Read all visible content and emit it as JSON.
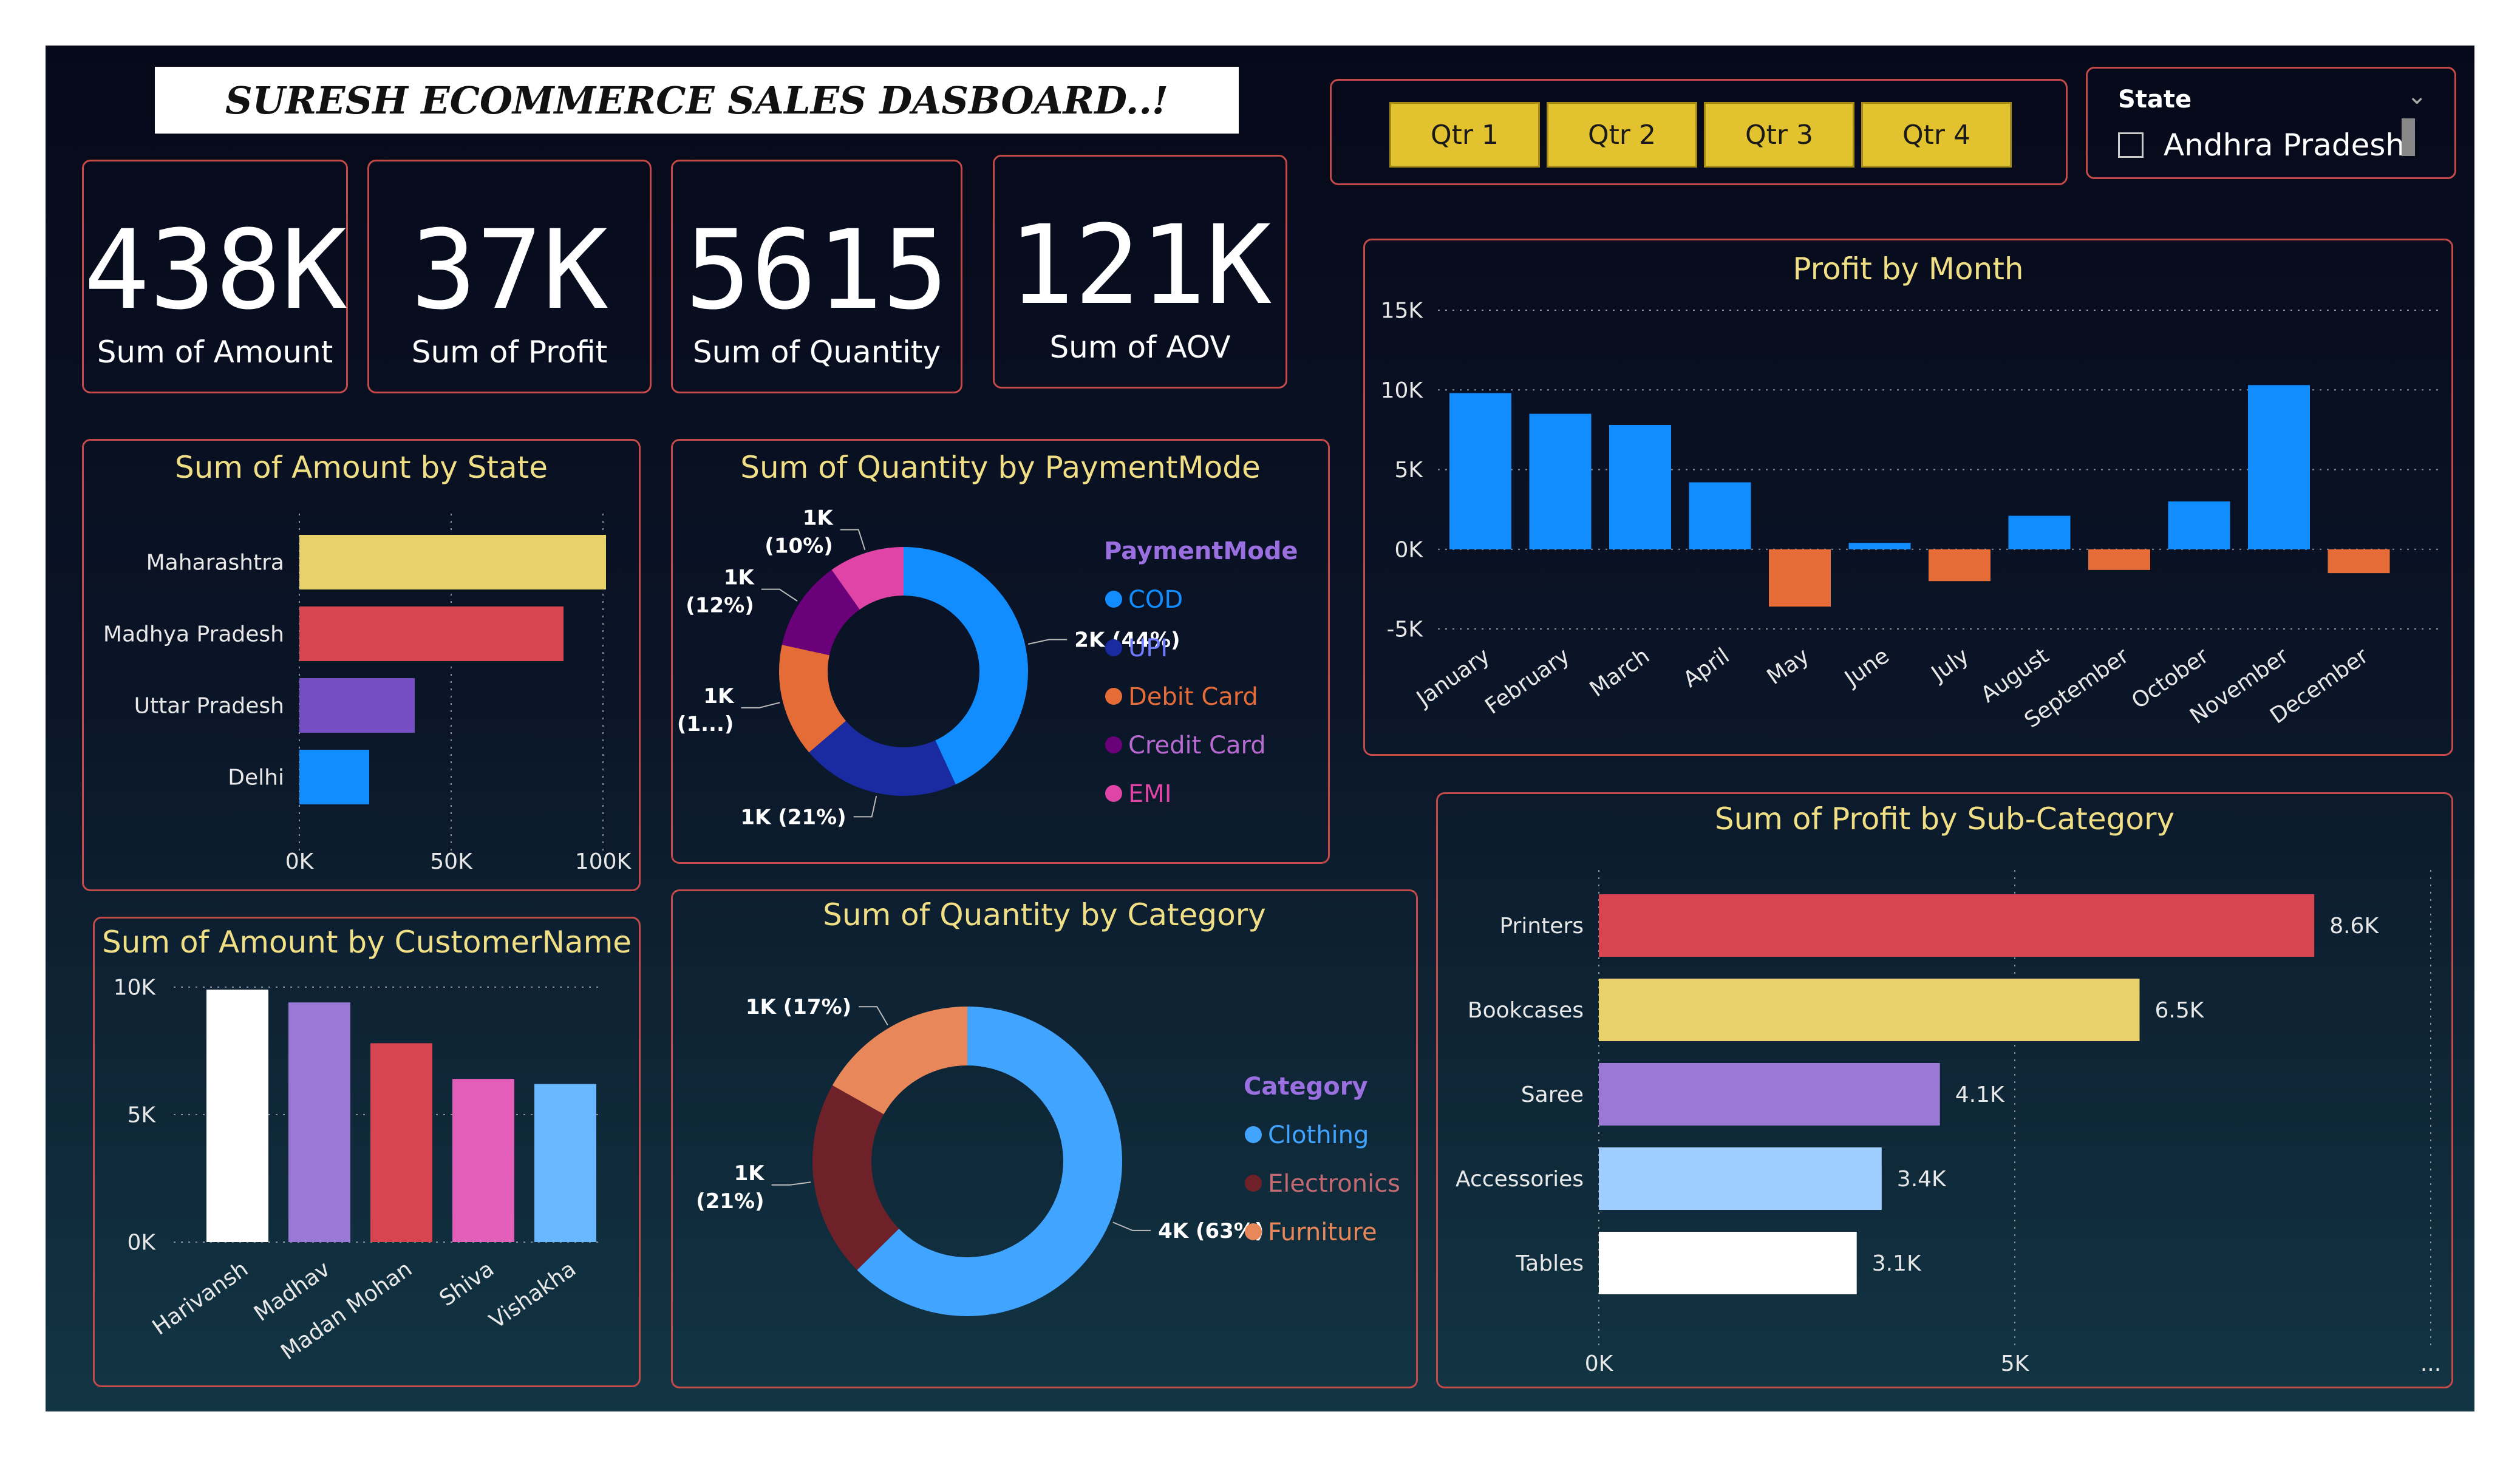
{
  "title": "SURESH ECOMMERCE  SALES DASBOARD..!",
  "kpis": [
    {
      "value": "438K",
      "label": "Sum of Amount"
    },
    {
      "value": "37K",
      "label": "Sum of Profit"
    },
    {
      "value": "5615",
      "label": "Sum of Quantity"
    },
    {
      "value": "121K",
      "label": "Sum of AOV"
    }
  ],
  "quarters": [
    "Qtr 1",
    "Qtr 2",
    "Qtr 3",
    "Qtr 4"
  ],
  "state_slicer": {
    "header": "State",
    "option": "Andhra Pradesh",
    "checked": false
  },
  "colors": {
    "accent": "#e3c230",
    "border": "#c44a4a",
    "title_text": "#f1df86",
    "blue": "#118dff",
    "orange": "#e66c37"
  },
  "chart_data": [
    {
      "type": "bar",
      "orientation": "horizontal",
      "title": "Sum of Amount by State",
      "categories": [
        "Maharashtra",
        "Madhya Pradesh",
        "Uttar Pradesh",
        "Delhi"
      ],
      "values": [
        101000,
        87000,
        38000,
        23000
      ],
      "colors": [
        "#e8d06a",
        "#d64550",
        "#744ec2",
        "#118dff"
      ],
      "xticks": [
        "0K",
        "50K",
        "100K"
      ],
      "xlim": [
        0,
        100000
      ],
      "grid": true
    },
    {
      "type": "pie",
      "subtype": "donut",
      "title": "Sum of Quantity by PaymentMode",
      "legend_title": "PaymentMode",
      "labels": [
        "COD",
        "UPI",
        "Debit Card",
        "Credit Card",
        "EMI"
      ],
      "values": [
        2469,
        1179,
        842,
        674,
        561
      ],
      "colors": [
        "#118dff",
        "#1a2aa0",
        "#e66c37",
        "#6b007b",
        "#e044a7"
      ],
      "data_labels": [
        "2K (44%)",
        "1K (21%)",
        "1K (1...)",
        "1K (12%)",
        "1K (10%)"
      ],
      "legend_position": "right"
    },
    {
      "type": "bar",
      "title": "Profit by Month",
      "categories": [
        "January",
        "February",
        "March",
        "April",
        "May",
        "June",
        "July",
        "August",
        "September",
        "October",
        "November",
        "December"
      ],
      "values": [
        9800,
        8500,
        7800,
        4200,
        -3600,
        400,
        -2000,
        2100,
        -1300,
        3000,
        10300,
        -1500
      ],
      "colors": {
        "positive": "#118dff",
        "negative": "#e66c37"
      },
      "yticks": [
        "15K",
        "10K",
        "5K",
        "0K",
        "-5K"
      ],
      "ylim": [
        -5000,
        15000
      ],
      "grid": true
    },
    {
      "type": "bar",
      "title": "Sum of Amount by CustomerName",
      "categories": [
        "Harivansh",
        "Madhav",
        "Madan Mohan",
        "Shiva",
        "Vishakha"
      ],
      "values": [
        9900,
        9400,
        7800,
        6400,
        6200
      ],
      "colors": [
        "#ffffff",
        "#9a78d6",
        "#d64550",
        "#e45fb9",
        "#69b8ff"
      ],
      "yticks": [
        "10K",
        "5K",
        "0K"
      ],
      "ylim": [
        0,
        10000
      ],
      "grid": true
    },
    {
      "type": "pie",
      "subtype": "donut",
      "title": "Sum of Quantity by Category",
      "legend_title": "Category",
      "labels": [
        "Clothing",
        "Electronics",
        "Furniture"
      ],
      "values": [
        3516,
        1154,
        945
      ],
      "colors": [
        "#41a4ff",
        "#6e2128",
        "#e8875a"
      ],
      "data_labels": [
        "4K (63%)",
        "1K (21%)",
        "1K (17%)"
      ],
      "legend_position": "right"
    },
    {
      "type": "bar",
      "orientation": "horizontal",
      "title": "Sum of Profit by Sub-Category",
      "categories": [
        "Printers",
        "Bookcases",
        "Saree",
        "Accessories",
        "Tables"
      ],
      "values": [
        8600,
        6500,
        4100,
        3400,
        3100
      ],
      "data_labels": [
        "8.6K",
        "6.5K",
        "4.1K",
        "3.4K",
        "3.1K"
      ],
      "colors": [
        "#d64550",
        "#e8d06a",
        "#9a78d6",
        "#9fcdff",
        "#ffffff"
      ],
      "xticks": [
        "0K",
        "5K",
        "..."
      ],
      "xlim": [
        0,
        10000
      ],
      "grid": true
    }
  ]
}
